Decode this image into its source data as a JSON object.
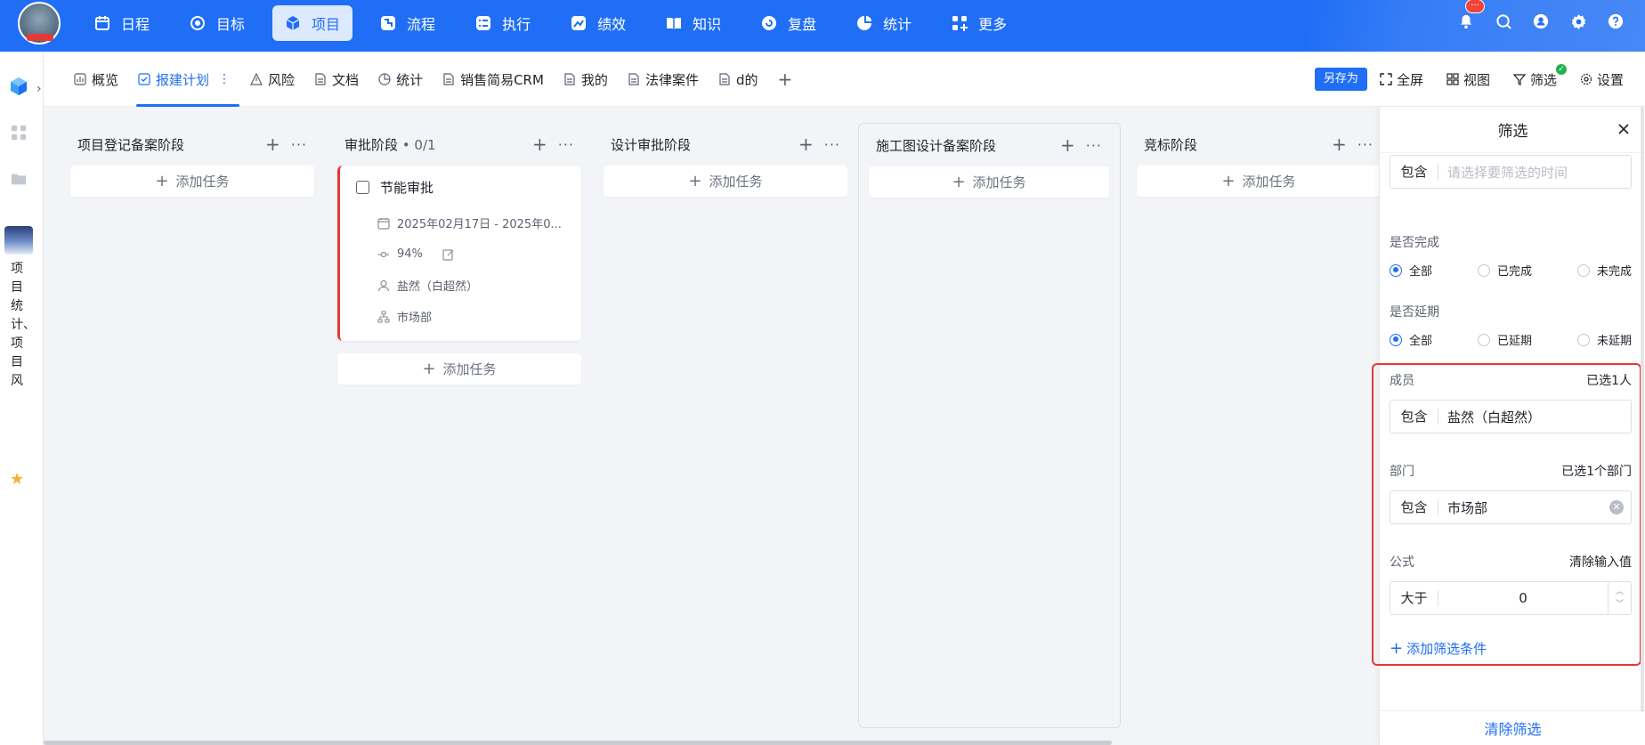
{
  "nav": {
    "items": [
      {
        "label": "日程",
        "icon": "calendar-icon"
      },
      {
        "label": "目标",
        "icon": "target-icon"
      },
      {
        "label": "项目",
        "icon": "cube-icon"
      },
      {
        "label": "流程",
        "icon": "flow-icon"
      },
      {
        "label": "执行",
        "icon": "checklist-icon"
      },
      {
        "label": "绩效",
        "icon": "performance-icon"
      },
      {
        "label": "知识",
        "icon": "book-icon"
      },
      {
        "label": "复盘",
        "icon": "review-icon"
      },
      {
        "label": "统计",
        "icon": "pie-chart-icon"
      },
      {
        "label": "更多",
        "icon": "grid-plus-icon"
      }
    ],
    "active": "项目",
    "badge": "···"
  },
  "rail": {
    "project_name": "项目统计、项目风"
  },
  "tabs": {
    "items": [
      "概览",
      "报建计划",
      "风险",
      "文档",
      "统计",
      "销售简易CRM",
      "我的",
      "法律案件",
      "d的"
    ],
    "active": "报建计划",
    "dots": "⋮",
    "add": "+"
  },
  "tab_actions": {
    "save_as": "另存为",
    "fullscreen": "全屏",
    "view": "视图",
    "filter": "筛选",
    "settings": "设置"
  },
  "board": {
    "add_task_label": "添加任务",
    "columns": [
      {
        "title": "项目登记备案阶段",
        "count": ""
      },
      {
        "title": "审批阶段",
        "count": " • 0/1"
      },
      {
        "title": "设计审批阶段",
        "count": ""
      },
      {
        "title": "施工图设计备案阶段",
        "count": ""
      },
      {
        "title": "竞标阶段",
        "count": ""
      }
    ],
    "card": {
      "title": "节能审批",
      "date_range": "2025年02月17日 - 2025年0...",
      "progress": "94%",
      "progress_value": 0.94,
      "assignee": "盐然（白超然）",
      "department": "市场部"
    }
  },
  "filter_panel": {
    "title": "筛选",
    "time": {
      "op": "包含",
      "placeholder": "请选择要筛选的时间"
    },
    "completed": {
      "label": "是否完成",
      "options": [
        "全部",
        "已完成",
        "未完成"
      ],
      "selected": "全部"
    },
    "delayed": {
      "label": "是否延期",
      "options": [
        "全部",
        "已延期",
        "未延期"
      ],
      "selected": "全部"
    },
    "member": {
      "label": "成员",
      "summary": "已选1人",
      "op": "包含",
      "value": "盐然（白超然）"
    },
    "department": {
      "label": "部门",
      "summary": "已选1个部门",
      "op": "包含",
      "value": "市场部"
    },
    "formula": {
      "label": "公式",
      "summary": "清除输入值",
      "op": "大于",
      "value": "0"
    },
    "add_condition": "添加筛选条件",
    "clear": "清除筛选"
  },
  "colors": {
    "brand": "#1f6ef5",
    "highlight": "#e53935",
    "success": "#22b14c"
  }
}
